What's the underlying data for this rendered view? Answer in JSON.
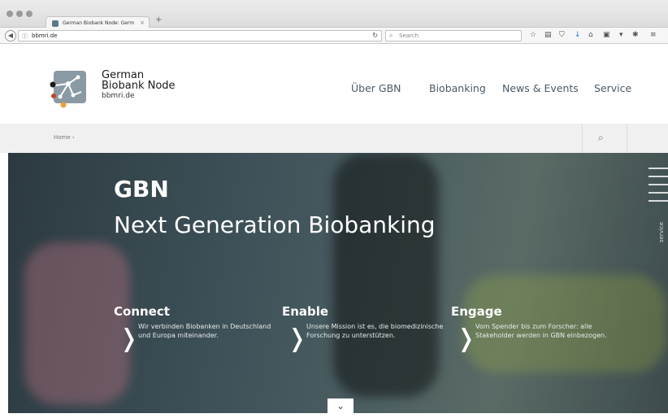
{
  "browser": {
    "tab_title": "German Biobank Node: Germ",
    "tab_close": "×",
    "new_tab": "+",
    "url": "bbmri.de",
    "search_placeholder": "Search"
  },
  "site": {
    "brand_line1": "German",
    "brand_line2": "Biobank Node",
    "brand_domain": "bbmri.de",
    "nav": [
      "Über GBN",
      "Biobanking",
      "News & Events",
      "Service"
    ]
  },
  "breadcrumb": {
    "home": "Home ›"
  },
  "hero": {
    "title": "GBN",
    "subtitle": "Next Generation Biobanking",
    "side_label": "service",
    "pillars": [
      {
        "heading": "Connect",
        "text": "Wir verbinden Biobanken in Deutschland und Europa miteinander."
      },
      {
        "heading": "Enable",
        "text": "Unsere Mission ist es, die biomedizinische Forschung zu unterstützen."
      },
      {
        "heading": "Engage",
        "text": "Vom Spender bis zum Forscher: alle Stakeholder werden in GBN einbezogen."
      }
    ]
  },
  "colors": {
    "accent_dark": "#2c3a40",
    "logo_orange": "#e8a13a",
    "logo_red": "#c4452a"
  }
}
